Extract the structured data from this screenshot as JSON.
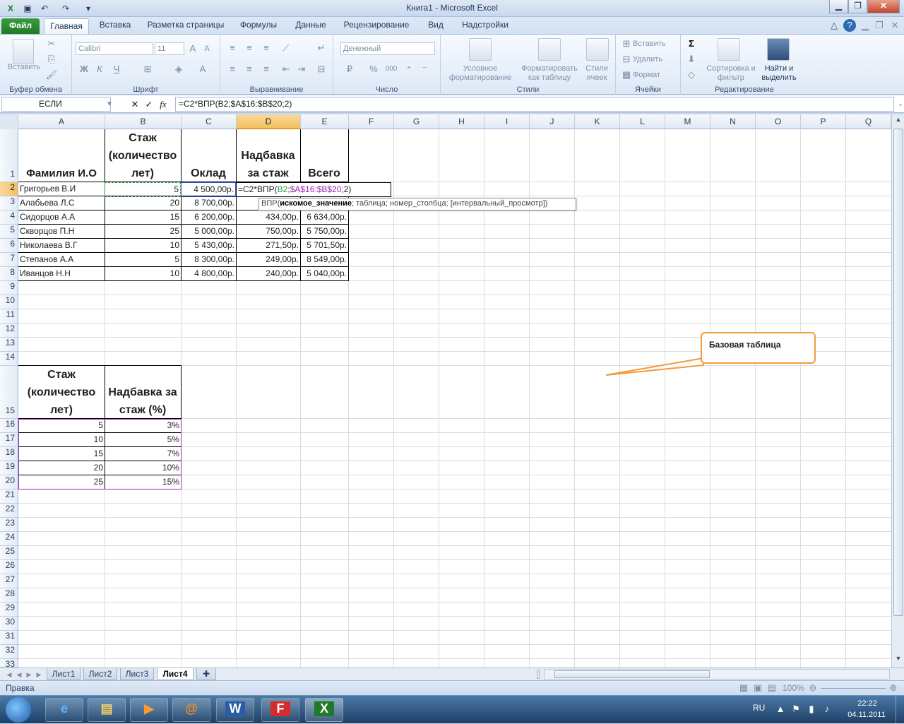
{
  "window": {
    "title": "Книга1  -  Microsoft Excel"
  },
  "tabs": [
    "Файл",
    "Главная",
    "Вставка",
    "Разметка страницы",
    "Формулы",
    "Данные",
    "Рецензирование",
    "Вид",
    "Надстройки"
  ],
  "ribbon": {
    "clipboard": {
      "paste": "Вставить",
      "group": "Буфер обмена"
    },
    "font": {
      "name": "Calibri",
      "size": "11",
      "group": "Шрифт",
      "bold": "Ж",
      "italic": "К",
      "underline": "Ч"
    },
    "alignment": {
      "group": "Выравнивание"
    },
    "number": {
      "format": "Денежный",
      "group": "Число",
      "percent": "%",
      "thousands": "000"
    },
    "styles": {
      "conditional": "Условное форматирование",
      "as_table": "Форматировать как таблицу",
      "cell_styles": "Стили ячеек",
      "group": "Стили"
    },
    "cells": {
      "insert": "Вставить",
      "delete": "Удалить",
      "format": "Формат",
      "group": "Ячейки"
    },
    "editing": {
      "sort": "Сортировка и фильтр",
      "find": "Найти и выделить",
      "group": "Редактирование",
      "sigma": "Σ"
    }
  },
  "formula_bar": {
    "name_box": "ЕСЛИ",
    "formula": "=C2*ВПР(B2;$A$16:$B$20;2)",
    "fx": "fx"
  },
  "columns": [
    "A",
    "B",
    "C",
    "D",
    "E",
    "F",
    "G",
    "H",
    "I",
    "J",
    "K",
    "L",
    "M",
    "N",
    "O",
    "P",
    "Q"
  ],
  "rows": [
    "1",
    "2",
    "3",
    "4",
    "5",
    "6",
    "7",
    "8",
    "9",
    "10",
    "11",
    "12",
    "13",
    "14",
    "15",
    "16",
    "17",
    "18",
    "19",
    "20",
    "21",
    "22",
    "23",
    "24",
    "25",
    "26",
    "27",
    "28",
    "29",
    "30",
    "31",
    "32",
    "33"
  ],
  "main_table": {
    "headers": [
      "Фамилия И.О",
      "Стаж (количество лет)",
      "Оклад",
      "Надбавка за стаж",
      "Всего"
    ],
    "rows": [
      [
        "Григорьев В.И",
        "5",
        "4 500,00р.",
        "",
        ""
      ],
      [
        "Алабьева Л.С",
        "20",
        "8 700,00р.",
        "",
        ""
      ],
      [
        "Сидорцов А.А",
        "15",
        "6 200,00р.",
        "434,00р.",
        "6 634,00р."
      ],
      [
        "Скворцов П.Н",
        "25",
        "5 000,00р.",
        "750,00р.",
        "5 750,00р."
      ],
      [
        "Николаева В.Г",
        "10",
        "5 430,00р.",
        "271,50р.",
        "5 701,50р."
      ],
      [
        "Степанов А.А",
        "5",
        "8 300,00р.",
        "249,00р.",
        "8 549,00р."
      ],
      [
        "Иванцов Н.Н",
        "10",
        "4 800,00р.",
        "240,00р.",
        "5 040,00р."
      ]
    ],
    "editing_formula": {
      "p1": "=C2*ВПР(",
      "p2": "B2",
      "p3": ";",
      "p4": "$A$16:$B$20",
      "p5": ";2)"
    }
  },
  "tooltip": {
    "func": "ВПР(",
    "arg1": "искомое_значение",
    "rest": "; таблица; номер_столбца; [интервальный_просмотр])"
  },
  "lookup_table": {
    "headers": [
      "Стаж (количество лет)",
      "Надбавка за стаж (%)"
    ],
    "rows": [
      [
        "5",
        "3%"
      ],
      [
        "10",
        "5%"
      ],
      [
        "15",
        "7%"
      ],
      [
        "20",
        "10%"
      ],
      [
        "25",
        "15%"
      ]
    ]
  },
  "callout": {
    "text": "Базовая таблица"
  },
  "sheets": [
    "Лист1",
    "Лист2",
    "Лист3",
    "Лист4"
  ],
  "status": {
    "mode": "Правка",
    "zoom": "100%"
  },
  "taskbar": {
    "lang": "RU",
    "time": "22:22",
    "date": "04.11.2011"
  }
}
